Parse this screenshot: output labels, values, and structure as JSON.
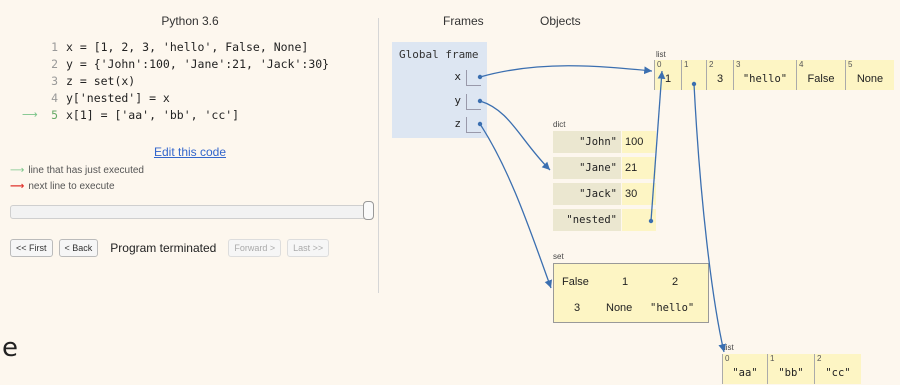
{
  "header": {
    "language": "Python 3.6",
    "frames_label": "Frames",
    "objects_label": "Objects"
  },
  "code": {
    "lines": [
      {
        "num": "1",
        "text": "x = [1, 2, 3, 'hello', False, None]"
      },
      {
        "num": "2",
        "text": "y = {'John':100, 'Jane':21, 'Jack':30}"
      },
      {
        "num": "3",
        "text": "z = set(x)"
      },
      {
        "num": "4",
        "text": "y['nested'] = x"
      },
      {
        "num": "5",
        "text": "x[1] = ['aa', 'bb', 'cc']"
      }
    ],
    "edit_link": "Edit this code"
  },
  "legend": {
    "executed": "line that has just executed",
    "next": "next line to execute"
  },
  "nav": {
    "first": "<< First",
    "back": "< Back",
    "status": "Program terminated",
    "forward": "Forward >",
    "last": "Last >>"
  },
  "global_frame": {
    "title": "Global frame",
    "vars": [
      "x",
      "y",
      "z"
    ]
  },
  "list_main": {
    "label": "list",
    "cells": [
      {
        "idx": "0",
        "val": "1"
      },
      {
        "idx": "1",
        "val": ""
      },
      {
        "idx": "2",
        "val": "3"
      },
      {
        "idx": "3",
        "val": "\"hello\""
      },
      {
        "idx": "4",
        "val": "False"
      },
      {
        "idx": "5",
        "val": "None"
      }
    ]
  },
  "dict": {
    "label": "dict",
    "entries": [
      {
        "key": "\"John\"",
        "val": "100"
      },
      {
        "key": "\"Jane\"",
        "val": "21"
      },
      {
        "key": "\"Jack\"",
        "val": "30"
      },
      {
        "key": "\"nested\"",
        "val": ""
      }
    ]
  },
  "set": {
    "label": "set",
    "items": [
      "False",
      "1",
      "2",
      "3",
      "None",
      "\"hello\""
    ]
  },
  "list_nested": {
    "label": "list",
    "cells": [
      {
        "idx": "0",
        "val": "\"aa\""
      },
      {
        "idx": "1",
        "val": "\"bb\""
      },
      {
        "idx": "2",
        "val": "\"cc\""
      }
    ]
  },
  "stray_char": "e",
  "colors": {
    "arrow": "#3b6fb0",
    "green_arrow": "#7bc58a",
    "red_arrow": "#e0342d",
    "frame_bg": "#dde6f2",
    "heap_bg": "#fdf5c4"
  }
}
